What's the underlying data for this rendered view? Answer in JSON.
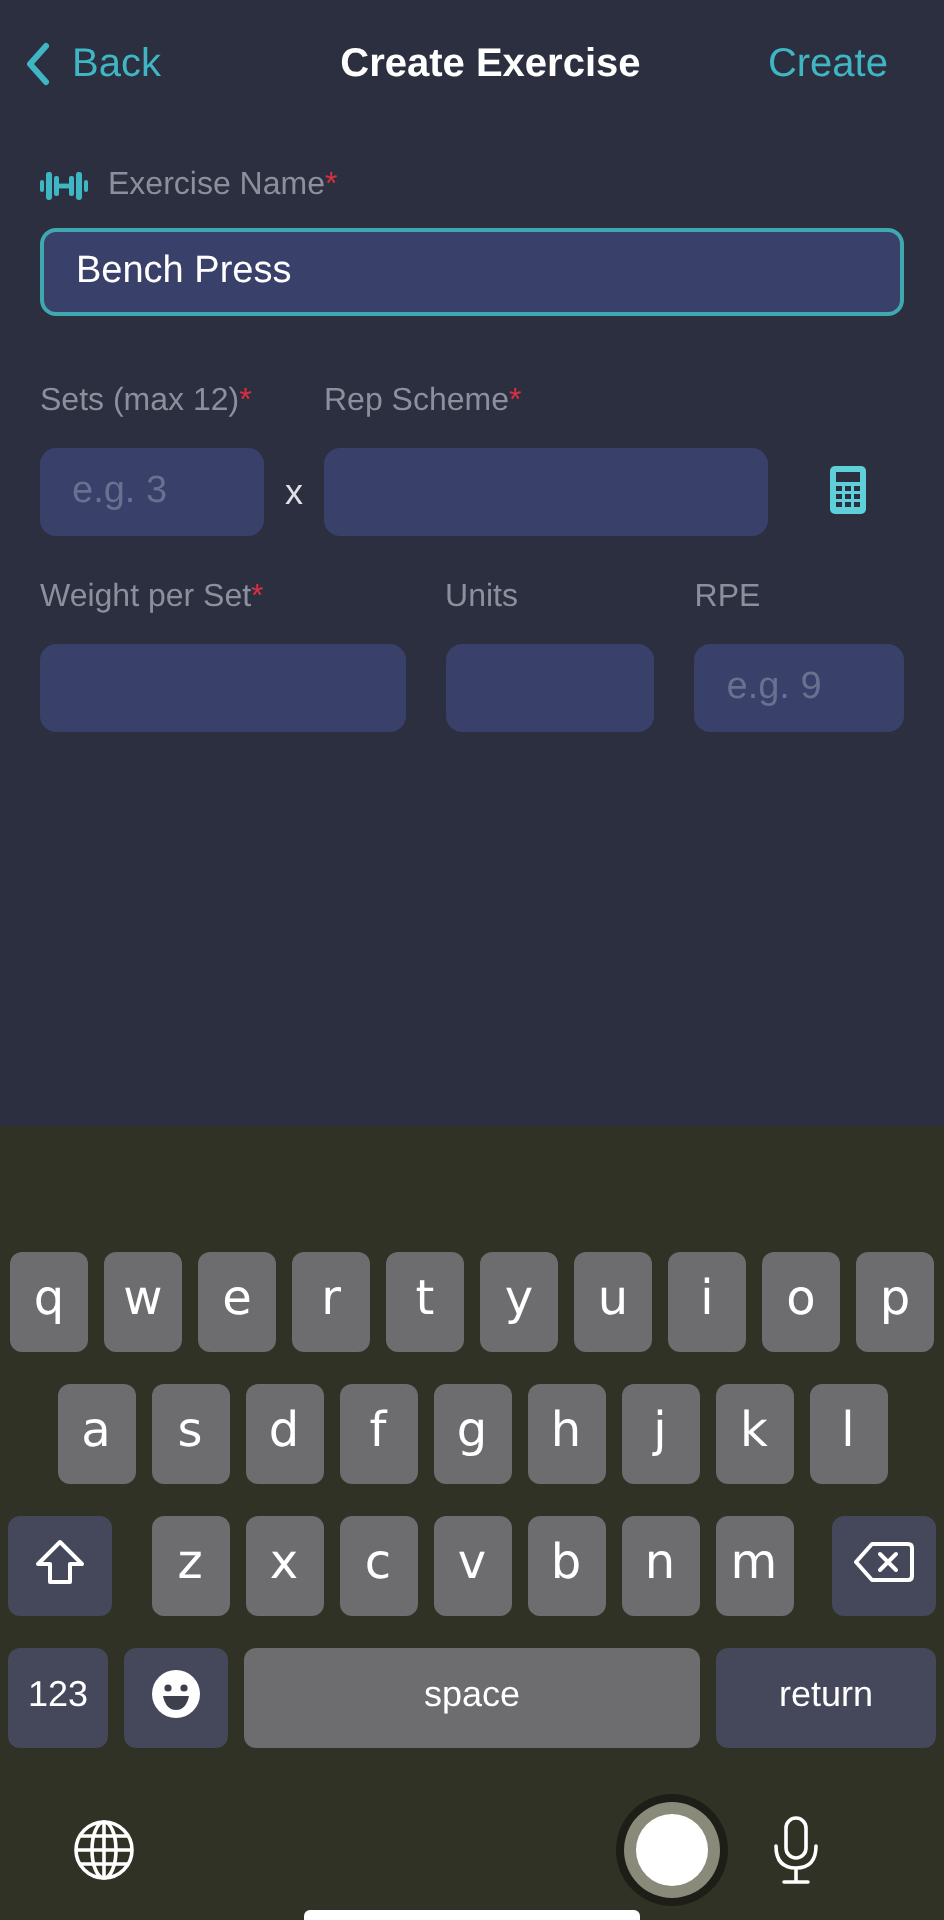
{
  "nav": {
    "back": "Back",
    "title": "Create Exercise",
    "action": "Create"
  },
  "exercise_name": {
    "label": "Exercise Name",
    "mark": "*",
    "value": "Bench Press",
    "focused": true
  },
  "sets": {
    "label": "Sets (max 12)",
    "mark": "*",
    "placeholder": "e.g. 3"
  },
  "times": "x",
  "rep_scheme": {
    "label": "Rep Scheme",
    "mark": "*"
  },
  "weight": {
    "label": "Weight per Set",
    "mark": "*"
  },
  "units": {
    "label": "Units"
  },
  "rpe": {
    "label": "RPE",
    "placeholder": "e.g. 9"
  },
  "keyboard": {
    "rows": [
      [
        "q",
        "w",
        "e",
        "r",
        "t",
        "y",
        "u",
        "i",
        "o",
        "p"
      ],
      [
        "a",
        "s",
        "d",
        "f",
        "g",
        "h",
        "j",
        "k",
        "l"
      ],
      [
        "z",
        "x",
        "c",
        "v",
        "b",
        "n",
        "m"
      ]
    ],
    "numbers": "123",
    "space": "space",
    "return": "return"
  }
}
